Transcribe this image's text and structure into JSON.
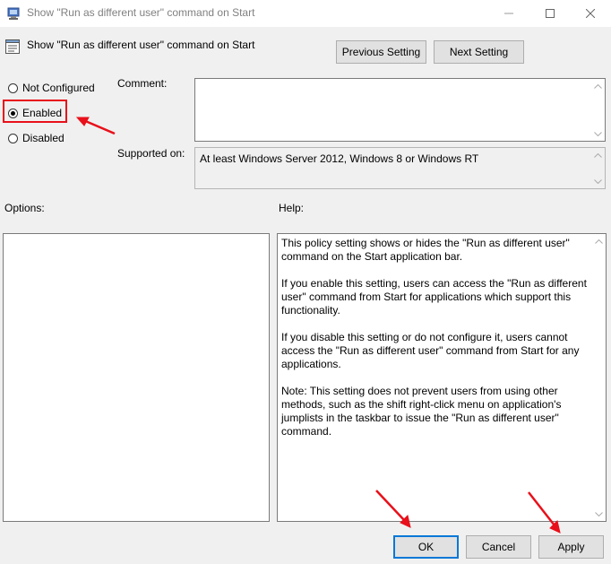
{
  "window": {
    "title": "Show \"Run as different user\" command on Start",
    "icon": "policy-icon",
    "controls": [
      "minimize-icon",
      "maximize-icon",
      "close-icon"
    ]
  },
  "header": {
    "policy_name": "Show \"Run as different user\" command on Start",
    "previous_label": "Previous Setting",
    "next_label": "Next Setting"
  },
  "state": {
    "options": [
      {
        "label": "Not Configured",
        "checked": false
      },
      {
        "label": "Enabled",
        "checked": true
      },
      {
        "label": "Disabled",
        "checked": false
      }
    ]
  },
  "comment": {
    "label": "Comment:",
    "value": ""
  },
  "supported": {
    "label": "Supported on:",
    "value": "At least Windows Server 2012, Windows 8 or Windows RT"
  },
  "options_label": "Options:",
  "help": {
    "label": "Help:",
    "paragraphs": [
      "This policy setting shows or hides the \"Run as different user\" command on the Start application bar.",
      "If you enable this setting, users can access the \"Run as different user\" command from Start for applications which support this functionality.",
      "If you disable this setting or do not configure it, users cannot access the \"Run as different user\" command from Start for any applications.",
      "Note: This setting does not prevent users from using other methods, such as the shift right-click menu on application's jumplists in the taskbar to issue the \"Run as different user\" command."
    ]
  },
  "footer": {
    "ok_label": "OK",
    "cancel_label": "Cancel",
    "apply_label": "Apply"
  },
  "colors": {
    "annotation": "#e8101a",
    "focus": "#0078d7",
    "background": "#f0f0f0"
  }
}
